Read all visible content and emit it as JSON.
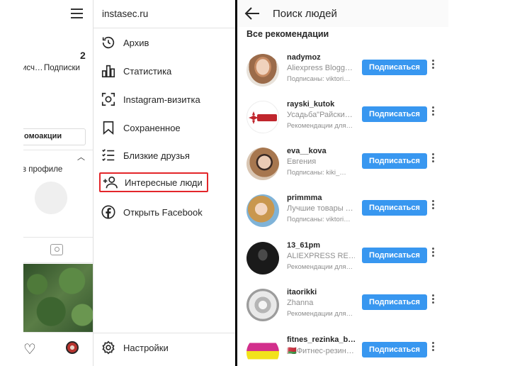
{
  "left": {
    "profile": {
      "following_count": "2",
      "followers_label_fragment": "исч…",
      "following_label": "Подписки",
      "promo_button": "омоакции",
      "in_profile_text": "в профиле"
    },
    "drawer": {
      "title": "instasec.ru",
      "items": [
        {
          "label": "Архив",
          "icon": "archive-icon"
        },
        {
          "label": "Статистика",
          "icon": "stats-icon"
        },
        {
          "label": "Instagram-визитка",
          "icon": "nametag-icon"
        },
        {
          "label": "Сохраненное",
          "icon": "bookmark-icon"
        },
        {
          "label": "Близкие друзья",
          "icon": "close-friends-icon"
        },
        {
          "label": "Интересные люди",
          "icon": "add-person-icon"
        },
        {
          "label": "Открыть Facebook",
          "icon": "facebook-icon"
        }
      ],
      "settings_label": "Настройки",
      "highlight_color": "#e3262a"
    }
  },
  "right": {
    "title": "Поиск людей",
    "section_title": "Все рекомендации",
    "follow_label": "Подписаться",
    "accent_color": "#3897f0",
    "users": [
      {
        "username": "nadymoz",
        "full_name": "Aliexpress Blogg…",
        "hint": "Подписаны: viktori…"
      },
      {
        "username": "rayski_kutok",
        "full_name": "Усадьба\"Райски…",
        "hint": "Рекомендации для…"
      },
      {
        "username": "eva__kova",
        "full_name": "Евгения",
        "hint": "Подписаны: kiki_…"
      },
      {
        "username": "primmma",
        "full_name": "Лучшие товары …",
        "hint": "Подписаны: viktori…"
      },
      {
        "username": "13_61pm",
        "full_name": "ALIEXPRESS RE…",
        "hint": "Рекомендации для…"
      },
      {
        "username": "itaorikki",
        "full_name": "Zhanna",
        "hint": "Рекомендации для…"
      },
      {
        "username": "fitnes_rezinka_b…",
        "full_name": "🇧🇾Фитнес-резин…",
        "hint": ""
      }
    ]
  }
}
